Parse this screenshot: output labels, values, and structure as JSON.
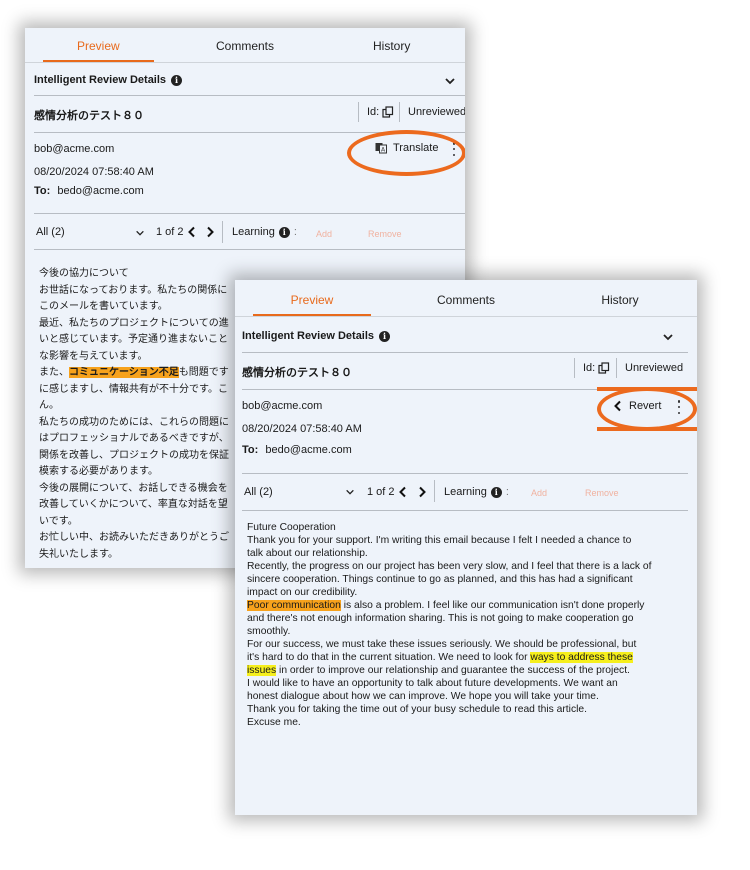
{
  "back_panel": {
    "tabs": [
      "Preview",
      "Comments",
      "History"
    ],
    "section_title": "Intelligent Review Details",
    "doc_title": "感情分析のテスト８０",
    "id_label": "Id:",
    "status": "Unreviewed",
    "from": "bob@acme.com",
    "date": "08/20/2024 07:58:40 AM",
    "to_label": "To:",
    "to": "bedo@acme.com",
    "action_label": "Translate",
    "filter": {
      "selected": "All (2)",
      "pager": "1 of 2",
      "learning_label": "Learning",
      "colon": ":",
      "add": "Add",
      "remove": "Remove"
    },
    "body_lines": [
      {
        "pre": "今後の協力について",
        "hl": "",
        "post": ""
      },
      {
        "pre": "お世話になっております。私たちの関係に",
        "hl": "",
        "post": ""
      },
      {
        "pre": "このメールを書いています。",
        "hl": "",
        "post": ""
      },
      {
        "pre": "最近、私たちのプロジェクトについての進",
        "hl": "",
        "post": ""
      },
      {
        "pre": "いと感じています。予定通り進まないこと",
        "hl": "",
        "post": ""
      },
      {
        "pre": "な影響を与えています。",
        "hl": "",
        "post": ""
      },
      {
        "pre": "また、",
        "hl": "コミュニケーション不足",
        "post": "も問題です"
      },
      {
        "pre": "に感じますし、情報共有が不十分です。こ",
        "hl": "",
        "post": ""
      },
      {
        "pre": "ん。",
        "hl": "",
        "post": ""
      },
      {
        "pre": "私たちの成功のためには、これらの問題に",
        "hl": "",
        "post": ""
      },
      {
        "pre": "はプロフェッショナルであるべきですが、",
        "hl": "",
        "post": ""
      },
      {
        "pre": "関係を改善し、プロジェクトの成功を保証",
        "hl": "",
        "post": ""
      },
      {
        "pre": "模索する必要があります。",
        "hl": "",
        "post": ""
      },
      {
        "pre": "今後の展開について、お話しできる機会を",
        "hl": "",
        "post": ""
      },
      {
        "pre": "改善していくかについて、率直な対話を望",
        "hl": "",
        "post": ""
      },
      {
        "pre": "いです。",
        "hl": "",
        "post": ""
      },
      {
        "pre": "お忙しい中、お読みいただきありがとうご",
        "hl": "",
        "post": ""
      },
      {
        "pre": "失礼いたします。",
        "hl": "",
        "post": ""
      }
    ]
  },
  "front_panel": {
    "tabs": [
      "Preview",
      "Comments",
      "History"
    ],
    "section_title": "Intelligent Review Details",
    "doc_title": "感情分析のテスト８０",
    "id_label": "Id:",
    "status": "Unreviewed",
    "from": "bob@acme.com",
    "date": "08/20/2024 07:58:40 AM",
    "to_label": "To:",
    "to": "bedo@acme.com",
    "action_label": "Revert",
    "filter": {
      "selected": "All (2)",
      "pager": "1 of 2",
      "learning_label": "Learning",
      "colon": ":",
      "add": "Add",
      "remove": "Remove"
    },
    "body": {
      "l1": "Future Cooperation",
      "l2": "Thank you for your support. I'm writing this email because I felt I needed a chance to",
      "l3": "talk about our relationship.",
      "l4": "Recently, the progress on our project has been very slow, and I feel that there is a lack of",
      "l5": "sincere cooperation. Things continue to go as planned, and this has had a significant",
      "l6": "impact on our credibility.",
      "l7_hl": "Poor communication",
      "l7_rest": " is also a problem. I feel like our communication isn't done properly",
      "l8": "and there's not enough information sharing. This is not going to make cooperation go",
      "l9": "smoothly.",
      "l10": "For our success, we must take these issues seriously. We should be professional, but",
      "l11_pre": "it's hard to do that in the current situation. We need to look for ",
      "l11_hl": "ways to address these",
      "l12_hl": "issues",
      "l12_rest": " in order to improve our relationship and guarantee the success of the project.",
      "l13": "I would like to have an opportunity to talk about future developments. We want an",
      "l14": "honest dialogue about how we can improve. We hope you will take your time.",
      "l15": "Thank you for taking the time out of your busy schedule to read this article.",
      "l16": "Excuse me."
    }
  },
  "colors": {
    "accent": "#e86a1c",
    "highlight_orange": "#f7a21c",
    "highlight_yellow": "#f6ef1d",
    "panel_bg": "#eef3fa"
  },
  "icons": [
    "info-icon",
    "chevron-down-icon",
    "copy-icon",
    "translate-icon",
    "chevron-left-icon",
    "chevron-right-icon",
    "more-vertical-icon"
  ]
}
